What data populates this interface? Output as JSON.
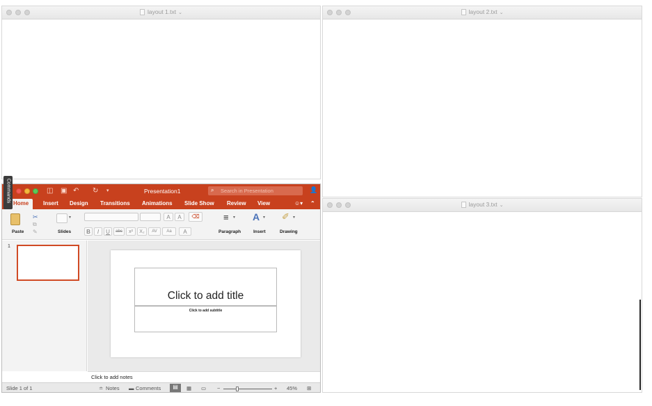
{
  "editors": [
    {
      "title": "layout 1.txt",
      "chevron": "⌄"
    },
    {
      "title": "layout 2.txt",
      "chevron": "⌄"
    },
    {
      "title": "layout 3.txt",
      "chevron": "⌄"
    }
  ],
  "commands_tab": "Commands",
  "ppt": {
    "title": "Presentation1",
    "search_placeholder": "Search in Presentation",
    "tabs": [
      "Home",
      "Insert",
      "Design",
      "Transitions",
      "Animations",
      "Slide Show",
      "Review",
      "View"
    ],
    "ribbon": {
      "paste": "Paste",
      "slides": "Slides",
      "paragraph": "Paragraph",
      "insert": "Insert",
      "drawing": "Drawing",
      "font_buttons": [
        "B",
        "I",
        "U",
        "abc",
        "x²",
        "X₂",
        "AV",
        "Aa",
        "A"
      ]
    },
    "thumb_number": "1",
    "slide_title": "Click to add title",
    "slide_subtitle": "Click to add subtitle",
    "notes_placeholder": "Click to add notes",
    "status": {
      "slide_count": "Slide 1 of 1",
      "notes": "Notes",
      "comments": "Comments",
      "zoom": "45%"
    }
  },
  "colors": {
    "accent": "#c8411e",
    "selection": "#d04a24"
  }
}
